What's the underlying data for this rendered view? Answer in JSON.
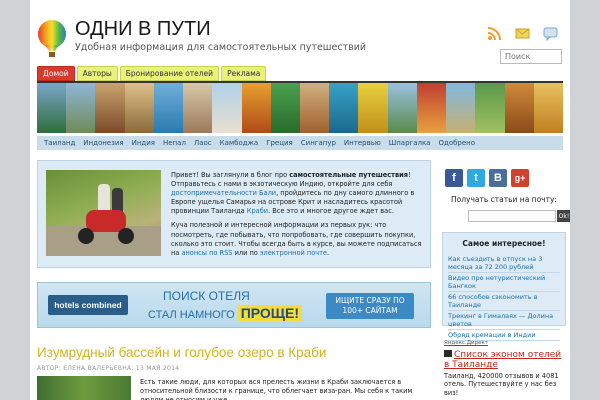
{
  "site": {
    "title": "ОДНИ В ПУТИ",
    "description": "Удобная информация для самостоятельных путешествий",
    "search_placeholder": "Поиск"
  },
  "header_icons": [
    "rss-icon",
    "email-icon",
    "chat-icon"
  ],
  "tabs": [
    "Домой",
    "Авторы",
    "Бронирование отелей",
    "Реклама"
  ],
  "categories": [
    "Таиланд",
    "Индонезия",
    "Индия",
    "Непал",
    "Лаос",
    "Камбоджа",
    "Греция",
    "Сингапур",
    "Интервью",
    "Шпаргалка",
    "Одобрено"
  ],
  "intro": {
    "p1_a": "Привет! Вы заглянули в блог про ",
    "p1_bold": "самостоятельные путешествия",
    "p1_b": "! Отправьтесь с нами в экзотическую Индию, откройте для себя ",
    "p1_link1": "достопримечательности Бали",
    "p1_c": ", пройдитесь по дну самого длинного в Европе ущелья Самарья на острове Крит и насладитесь красотой провинции Таиланда ",
    "p1_link2": "Краби",
    "p1_d": ". Все это и многое другое ждет вас.",
    "p2_a": "Куча полезной и интересной информации из первых рук: что посмотреть, где побывать, что попробовать, где совершить покупки, сколько это стоит. Чтобы всегда быть в курсе, вы можете подписаться на ",
    "p2_link1": "анонсы по RSS",
    "p2_b": " или по ",
    "p2_link2": "электронной почте",
    "p2_c": "."
  },
  "ad": {
    "logo": "hotels combined",
    "line1": "ПОИСК ОТЕЛЯ",
    "line2": "СТАЛ НАМНОГО",
    "line2_bold": "ПРОЩЕ!",
    "button": "ИЩИТЕ СРАЗУ ПО 100+ САЙТАМ"
  },
  "post": {
    "title": "Изумрудный бассейн и голубое озеро в Краби",
    "meta": "АВТОР: ЕЛЕНА ВАЛЕРЬЕВНА, 13 МАЯ 2014",
    "text": "Есть такие люди, для которых вся прелесть жизни в Краби заключается в относительной близости к границе, что облегчает визa-ран. Мы себя к таким людям не относим и уже"
  },
  "sidebar": {
    "social": [
      {
        "icon": "facebook-icon",
        "letter": "f",
        "color": "#3b5998"
      },
      {
        "icon": "twitter-icon",
        "letter": "t",
        "color": "#2fa9e0"
      },
      {
        "icon": "vk-icon",
        "letter": "B",
        "color": "#4b6f98"
      },
      {
        "icon": "googleplus-icon",
        "letter": "g+",
        "color": "#d2402f"
      }
    ],
    "mail_label": "Получать статьи на почту:",
    "mail_ok": "Ok!",
    "popular_title": "Самое интересное!",
    "popular_items": [
      "Как съездить в отпуск на 3 месяца за 72 200 рублей",
      "Видео про нетуристический Бангкок",
      "66 способов сэкономить в Таиланде",
      "Трекинг в Гималаях — Долина цветов",
      "Обряд кремации в Индии"
    ],
    "ya_direct": "Яндекс.Директ",
    "ya_ad_title": "Список эконом отелей в Таиланде",
    "ya_ad_text": "Таиланд, 420000 отзывов и 4081 отель. Путешествуйте у нас без виз!"
  }
}
